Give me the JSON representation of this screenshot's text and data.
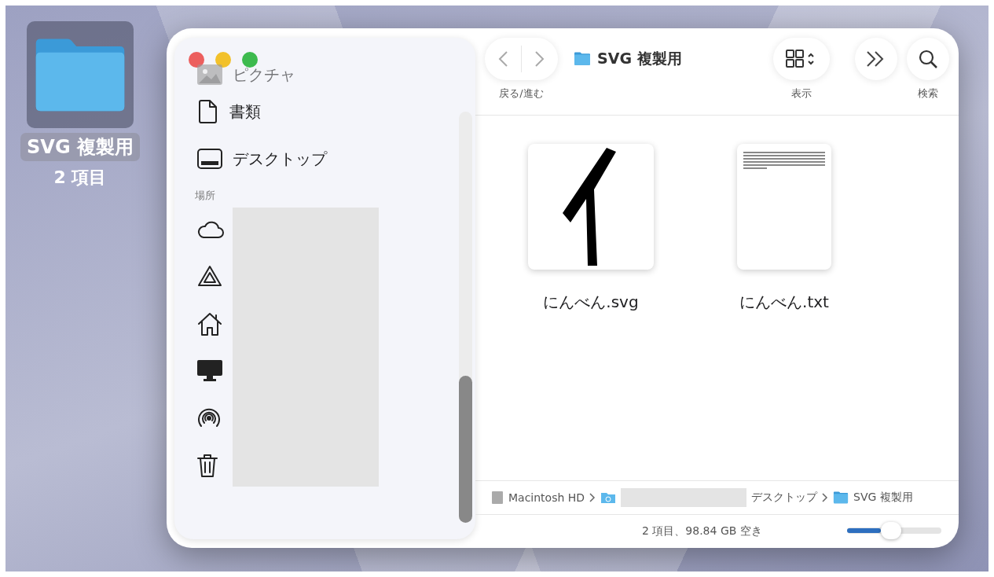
{
  "desktop_icon": {
    "name": "SVG 複製用",
    "info": "2 項目",
    "selected": true
  },
  "window": {
    "title": "SVG 複製用"
  },
  "toolbar": [
    {
      "kind": "navigation",
      "label": "戻る/進む"
    },
    {
      "kind": "view",
      "label": "表示"
    },
    {
      "kind": "more"
    },
    {
      "kind": "search",
      "label": "検索"
    }
  ],
  "sidebar": {
    "items": [
      {
        "label": "ピクチャ",
        "kind": "picture",
        "faded": true
      },
      {
        "label": "書類",
        "kind": "document",
        "faded": false
      },
      {
        "label": "デスクトップ",
        "kind": "desktop",
        "faded": false
      }
    ],
    "section": "場所",
    "locations": [
      {
        "kind": "cloud"
      },
      {
        "kind": "drive"
      },
      {
        "kind": "home"
      },
      {
        "kind": "monitor"
      },
      {
        "kind": "airdrop"
      },
      {
        "kind": "trash"
      }
    ]
  },
  "files": [
    {
      "name": "にんべん.svg",
      "kind": "image"
    },
    {
      "name": "にんべん.txt",
      "kind": "text"
    }
  ],
  "path_bar": [
    {
      "kind": "disk",
      "label": "Macintosh HD"
    },
    {
      "kind": "home"
    },
    {
      "kind": "plain",
      "label": "デスクトップ"
    },
    {
      "kind": "folder",
      "label": "SVG 複製用"
    }
  ],
  "status": {
    "text": "2 項目、98.84 GB 空き",
    "zoom": {
      "level": 0.36
    }
  }
}
